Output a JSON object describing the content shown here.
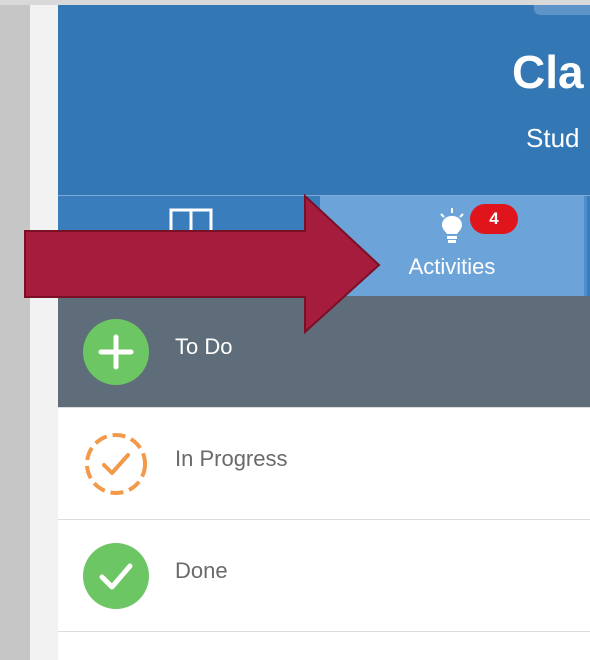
{
  "header": {
    "title": "Cla",
    "subtitle": "Stud"
  },
  "tabs": [
    {
      "icon": "book-icon",
      "label": ""
    },
    {
      "icon": "lightbulb-icon",
      "label": "Activities",
      "badge": "4",
      "active": true
    }
  ],
  "status_rows": [
    {
      "icon": "plus-circle-icon",
      "label": "To Do",
      "selected": true
    },
    {
      "icon": "in-progress-check-icon",
      "label": "In Progress"
    },
    {
      "icon": "done-check-icon",
      "label": "Done"
    }
  ],
  "colors": {
    "header_bg": "#3378b5",
    "tab_active_bg": "#6ca3d8",
    "selected_row_bg": "#5f6d7b",
    "badge_red": "#e0141b",
    "green": "#6cc663",
    "orange": "#f2994a",
    "arrow": "#a51c3c"
  }
}
